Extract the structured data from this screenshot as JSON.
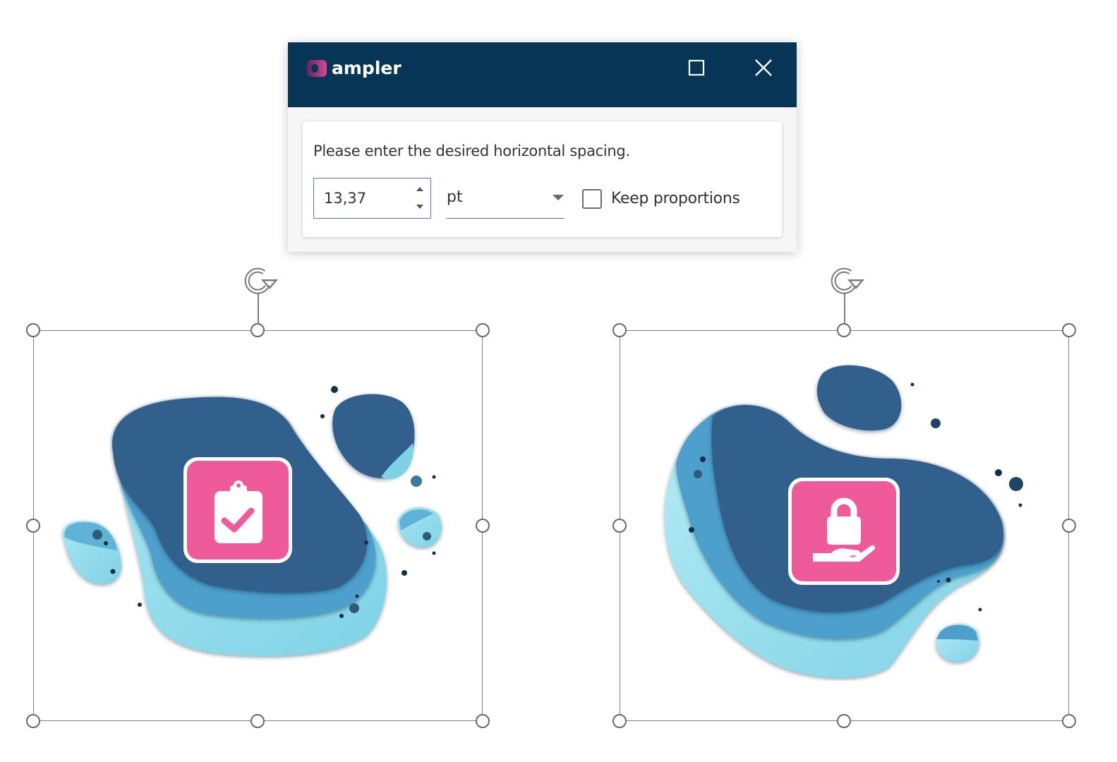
{
  "dialog": {
    "brand_name": "ampler",
    "maximize_icon": "maximize-icon",
    "close_icon": "close-icon",
    "prompt": "Please enter the desired horizontal spacing.",
    "spacing_value": "13,37",
    "unit_value": "pt",
    "keep_proportions_label": "Keep proportions",
    "keep_proportions_checked": false,
    "colors": {
      "titlebar": "#063556",
      "input_focus_border": "#4e7fd4",
      "brand_gradient_start": "#5a2a5e",
      "brand_gradient_end": "#d9468f"
    }
  },
  "canvas": {
    "shapes": [
      {
        "name": "clipboard-check-graphic",
        "icon": "clipboard-check-icon",
        "selected": true,
        "colors": {
          "badge": "#ef5a9b",
          "deep": "#33608c",
          "mid": "#4b93c4",
          "light": "#8fd8ea"
        }
      },
      {
        "name": "lock-hand-graphic",
        "icon": "lock-in-hand-icon",
        "selected": true,
        "colors": {
          "badge": "#ef5a9b",
          "deep": "#33608c",
          "mid": "#4b93c4",
          "light": "#8fd8ea"
        }
      }
    ]
  }
}
